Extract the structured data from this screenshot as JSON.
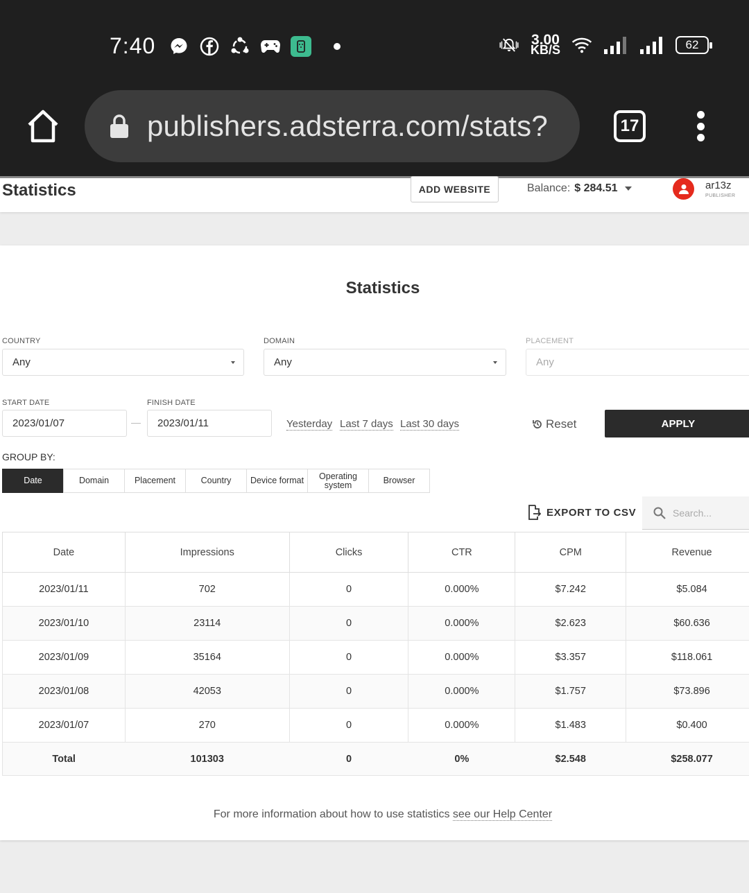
{
  "status_bar": {
    "time": "7:40",
    "net_speed_value": "3.00",
    "net_speed_unit": "KB/S",
    "battery": "62"
  },
  "browser": {
    "url": "publishers.adsterra.com/stats?",
    "tab_count": "17"
  },
  "header": {
    "title": "Statistics",
    "add_website": "ADD WEBSITE",
    "balance_label": "Balance:",
    "balance_value": "$ 284.51",
    "user_name": "ar13z",
    "user_role": "PUBLISHER"
  },
  "card": {
    "title": "Statistics",
    "filters": {
      "country_label": "COUNTRY",
      "country_value": "Any",
      "domain_label": "DOMAIN",
      "domain_value": "Any",
      "placement_label": "PLACEMENT",
      "placement_value": "Any",
      "start_label": "START DATE",
      "start_value": "2023/01/07",
      "finish_label": "FINISH DATE",
      "finish_value": "2023/01/11",
      "quick_yesterday": "Yesterday",
      "quick_7": "Last 7 days",
      "quick_30": "Last 30 days",
      "reset": "Reset",
      "apply": "APPLY"
    },
    "group_by": {
      "label": "GROUP BY:",
      "options": [
        "Date",
        "Domain",
        "Placement",
        "Country",
        "Device format",
        "Operating system",
        "Browser"
      ],
      "active": "Date"
    },
    "export": "EXPORT TO CSV",
    "search_placeholder": "Search...",
    "table": {
      "columns": [
        "Date",
        "Impressions",
        "Clicks",
        "CTR",
        "CPM",
        "Revenue"
      ],
      "rows": [
        [
          "2023/01/11",
          "702",
          "0",
          "0.000%",
          "$7.242",
          "$5.084"
        ],
        [
          "2023/01/10",
          "23114",
          "0",
          "0.000%",
          "$2.623",
          "$60.636"
        ],
        [
          "2023/01/09",
          "35164",
          "0",
          "0.000%",
          "$3.357",
          "$118.061"
        ],
        [
          "2023/01/08",
          "42053",
          "0",
          "0.000%",
          "$1.757",
          "$73.896"
        ],
        [
          "2023/01/07",
          "270",
          "0",
          "0.000%",
          "$1.483",
          "$0.400"
        ]
      ],
      "total": [
        "Total",
        "101303",
        "0",
        "0%",
        "$2.548",
        "$258.077"
      ]
    },
    "help_text": "For more information about how to use statistics",
    "help_link": "see our Help Center"
  }
}
